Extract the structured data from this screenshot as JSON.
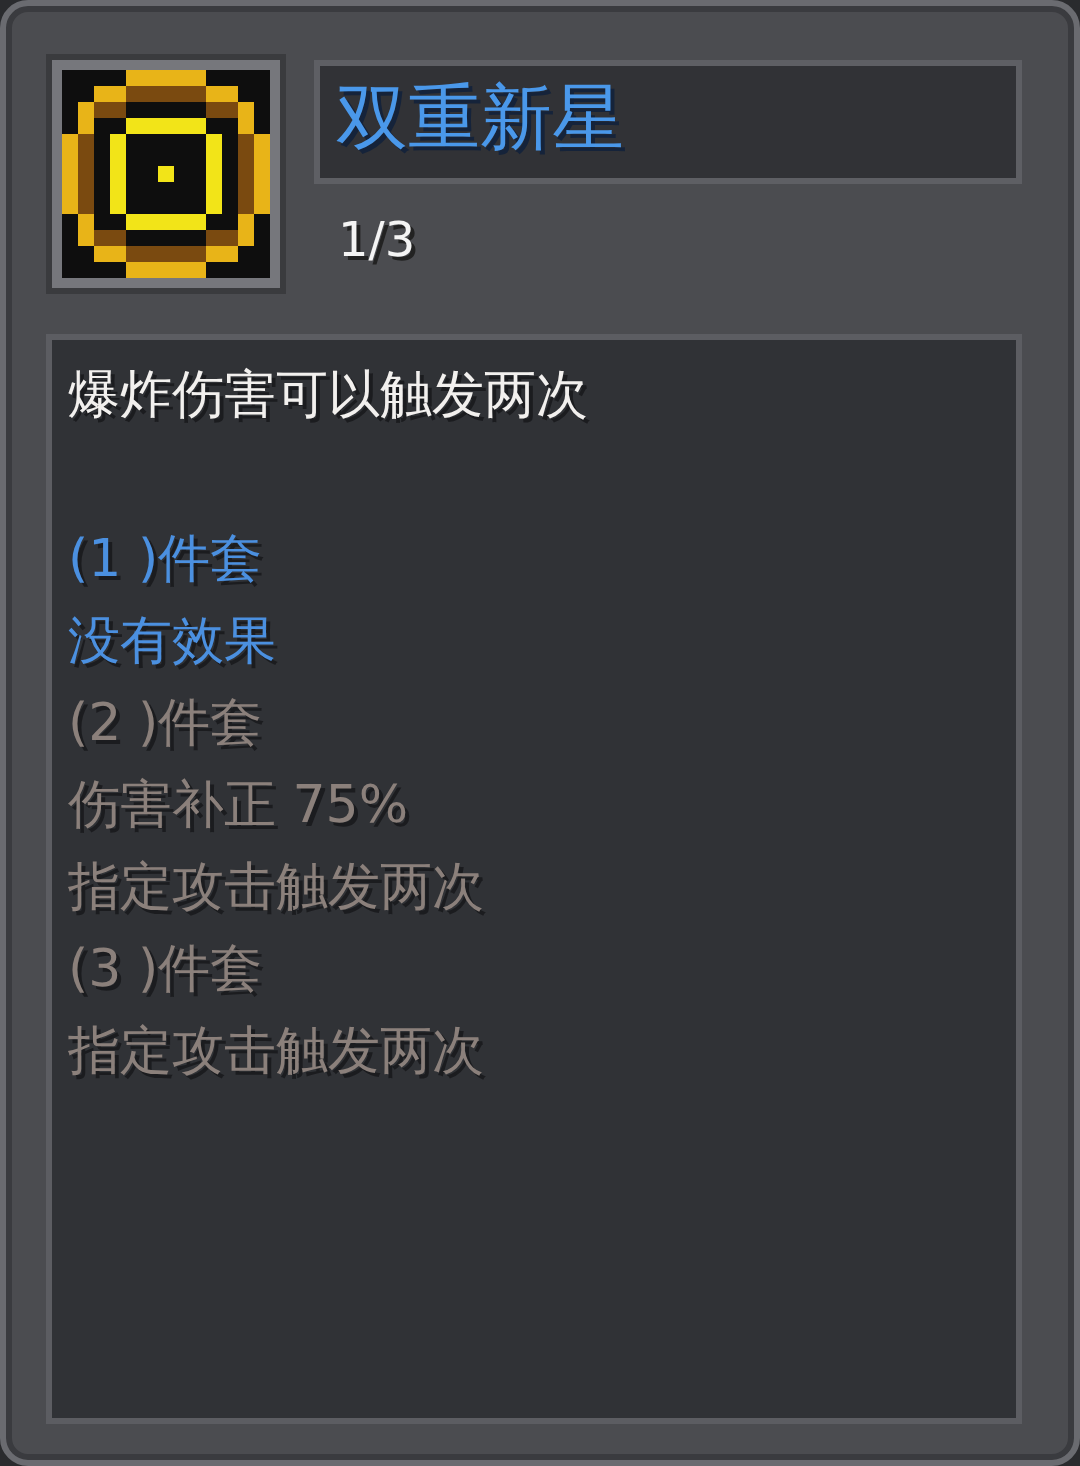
{
  "item": {
    "name": "双重新星",
    "count": "1/3"
  },
  "description": "爆炸伤害可以触发两次",
  "set_bonuses": [
    {
      "label": "(1 )件套",
      "active": true,
      "effects": [
        "没有效果"
      ]
    },
    {
      "label": "(2 )件套",
      "active": false,
      "effects": [
        "伤害补正 75%",
        "指定攻击触发两次"
      ]
    },
    {
      "label": "(3 )件套",
      "active": false,
      "effects": [
        "指定攻击触发两次"
      ]
    }
  ]
}
